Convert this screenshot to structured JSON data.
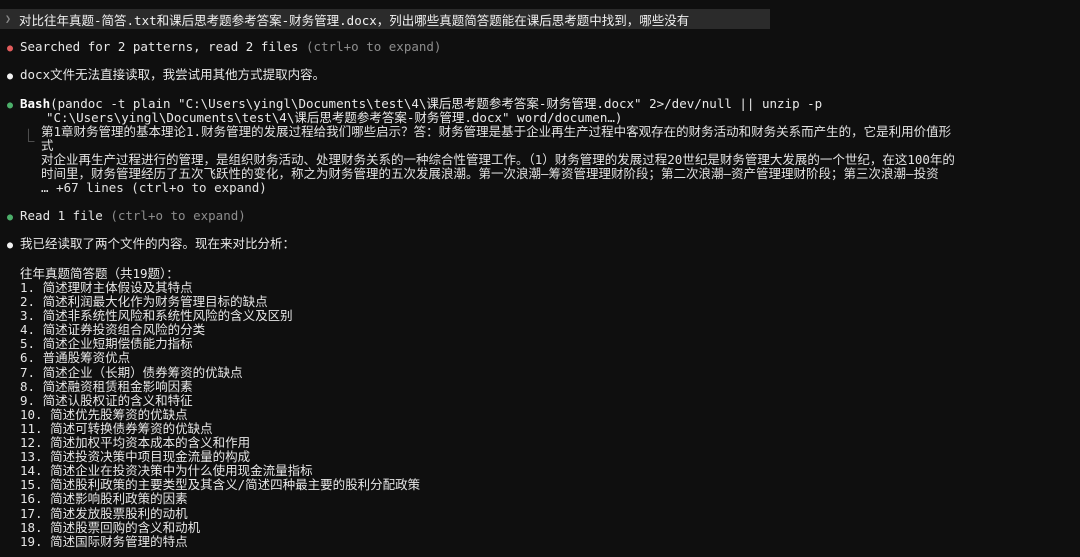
{
  "prompt": {
    "marker": "❯",
    "text": "对比往年真题-简答.txt和课后思考题参考答案-财务管理.docx，列出哪些真题简答题能在课后思考题中找到，哪些没有"
  },
  "searched": {
    "bullet": "●",
    "label": "Searched for 2 patterns, read 2 files",
    "hint": "(ctrl+o to expand)"
  },
  "note": {
    "bullet": "●",
    "text": "docx文件无法直接读取，我尝试用其他方式提取内容。"
  },
  "bash": {
    "bullet": "●",
    "tool": "Bash",
    "command_line1": "(pandoc -t plain \"C:\\Users\\yingl\\Documents\\test\\4\\课后思考题参考答案-财务管理.docx\" 2>/dev/null || unzip -p",
    "command_line2": "\"C:\\Users\\yingl\\Documents\\test\\4\\课后思考题参考答案-财务管理.docx\" word/documen…)",
    "corner": "⎿",
    "output_lines": [
      "第1章财务管理的基本理论1.财务管理的发展过程给我们哪些启示？答：财务管理是基于企业再生产过程中客观存在的财务活动和财务关系而产生的，它是利用价值形",
      "式",
      "对企业再生产过程进行的管理，是组织财务活动、处理财务关系的一种综合性管理工作。（1）财务管理的发展过程20世纪是财务管理大发展的一个世纪，在这100年的",
      "时间里，财务管理经历了五次飞跃性的变化，称之为财务管理的五次发展浪潮。第一次浪潮—筹资管理理财阶段；第二次浪潮—资产管理理财阶段；第三次浪潮—投资"
    ],
    "more": "… +67 lines (ctrl+o to expand)"
  },
  "read": {
    "bullet": "●",
    "label": "Read 1 file",
    "hint": "(ctrl+o to expand)"
  },
  "summary": {
    "bullet": "●",
    "text": "我已经读取了两个文件的内容。现在来对比分析："
  },
  "list": {
    "heading": "往年真题简答题（共19题）：",
    "items": [
      "1. 简述理财主体假设及其特点",
      "2. 简述利润最大化作为财务管理目标的缺点",
      "3. 简述非系统性风险和系统性风险的含义及区别",
      "4. 简述证券投资组合风险的分类",
      "5. 简述企业短期偿债能力指标",
      "6. 普通股筹资优点",
      "7. 简述企业（长期）债券筹资的优缺点",
      "8. 简述融资租赁租金影响因素",
      "9. 简述认股权证的含义和特征",
      "10. 简述优先股筹资的优缺点",
      "11. 简述可转换债券筹资的优缺点",
      "12. 简述加权平均资本成本的含义和作用",
      "13. 简述投资决策中项目现金流量的构成",
      "14. 简述企业在投资决策中为什么使用现金流量指标",
      "15. 简述股利政策的主要类型及其含义/简述四种最主要的股利分配政策",
      "16. 简述影响股利政策的因素",
      "17. 简述发放股票股利的动机",
      "18. 简述股票回购的含义和动机",
      "19. 简述国际财务管理的特点"
    ]
  },
  "colors": {
    "background": "#0f0f0f",
    "prompt_bar": "#2b2b2b",
    "bullet_red": "#e25c5c",
    "bullet_green": "#4caf6a",
    "dim_text": "#8d8d8d"
  }
}
